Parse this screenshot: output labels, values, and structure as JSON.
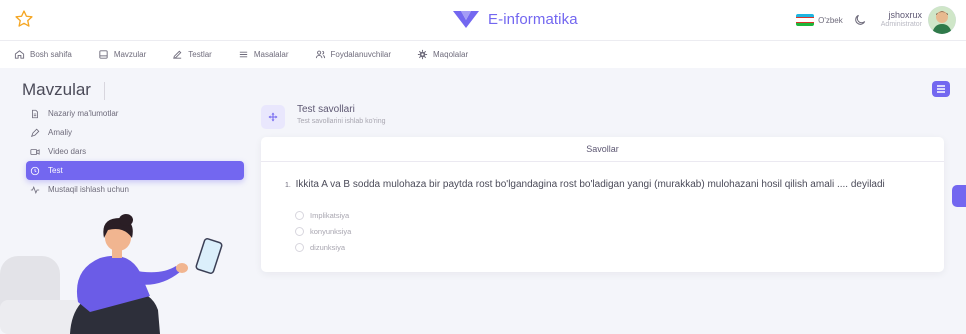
{
  "header": {
    "brand": "E-informatika",
    "language": "O'zbek",
    "user_name": "jshoxrux",
    "user_role": "Administrator"
  },
  "nav": {
    "items": [
      {
        "label": "Bosh sahifa",
        "icon": "home-icon"
      },
      {
        "label": "Mavzular",
        "icon": "book-icon"
      },
      {
        "label": "Testlar",
        "icon": "pencil-icon"
      },
      {
        "label": "Masalalar",
        "icon": "list-icon"
      },
      {
        "label": "Foydalanuvchilar",
        "icon": "users-icon"
      },
      {
        "label": "Maqolalar",
        "icon": "gear-icon"
      }
    ]
  },
  "sidebar": {
    "title": "Mavzular",
    "items": [
      {
        "label": "Nazariy ma'lumotlar",
        "icon": "document-icon",
        "active": false
      },
      {
        "label": "Amaliy",
        "icon": "pen-icon",
        "active": false
      },
      {
        "label": "Video dars",
        "icon": "video-icon",
        "active": false
      },
      {
        "label": "Test",
        "icon": "clock-icon",
        "active": true
      },
      {
        "label": "Mustaqil ishlash uchun",
        "icon": "activity-icon",
        "active": false
      }
    ]
  },
  "main": {
    "section_title": "Test savollari",
    "section_subtitle": "Test savollarini ishlab ko'ring",
    "card_title": "Savollar",
    "question_number": "1.",
    "question_text": "Ikkita A va B sodda mulohaza bir paytda rost bo'lgandagina rost bo'ladigan yangi (murakkab) mulohazani hosil qilish amali .... deyiladi",
    "options": [
      "Implikatsiya",
      "konyunksiya",
      "dizunksiya"
    ]
  },
  "colors": {
    "accent": "#7367f0",
    "background": "#f4f5fa",
    "star": "#f5a623"
  }
}
